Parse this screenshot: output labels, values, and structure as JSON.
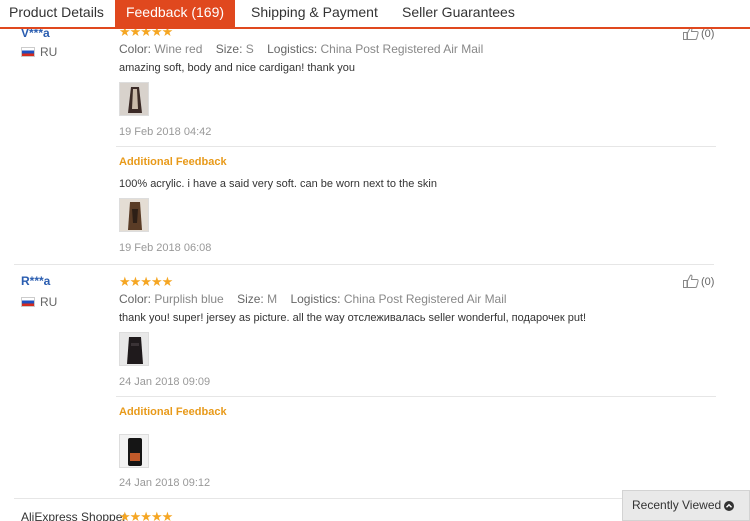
{
  "tabs": [
    {
      "label": "Product Details"
    },
    {
      "label": "Feedback (169)"
    },
    {
      "label": "Shipping & Payment"
    },
    {
      "label": "Seller Guarantees"
    }
  ],
  "reviews": [
    {
      "buyer": "V***a",
      "country": "RU",
      "stars": "★★★★★",
      "color_label": "Color:",
      "color": "Wine red",
      "size_label": "Size:",
      "size": "S",
      "logistics_label": "Logistics:",
      "logistics": "China Post Registered Air Mail",
      "text": "amazing soft, body and nice cardigan! thank you",
      "date": "19 Feb 2018 04:42",
      "additional_label": "Additional Feedback",
      "additional_text": "100% acrylic. i have a said very soft. can be worn next to the skin",
      "additional_date": "19 Feb 2018 06:08",
      "helpful_count": "(0)"
    },
    {
      "buyer": "R***a",
      "country": "RU",
      "stars": "★★★★★",
      "color_label": "Color:",
      "color": "Purplish blue",
      "size_label": "Size:",
      "size": "M",
      "logistics_label": "Logistics:",
      "logistics": "China Post Registered Air Mail",
      "text": "thank you! super! jersey as picture. all the way отслеживалась seller wonderful, подарочек put!",
      "date": "24 Jan 2018 09:09",
      "additional_label": "Additional Feedback",
      "additional_date": "24 Jan 2018 09:12",
      "helpful_count": "(0)"
    },
    {
      "buyer": "AliExpress Shopper",
      "stars": "★★★★★"
    }
  ],
  "recently_viewed": {
    "label": "Recently Viewed"
  },
  "colors": {
    "accent": "#e0481e",
    "link": "#2a5db0",
    "star": "#f5a623",
    "additional": "#e89a1a"
  },
  "icons": {
    "helpful": "thumbs-up-icon",
    "flag": "russia-flag-icon",
    "expand": "chevron-up-icon"
  }
}
